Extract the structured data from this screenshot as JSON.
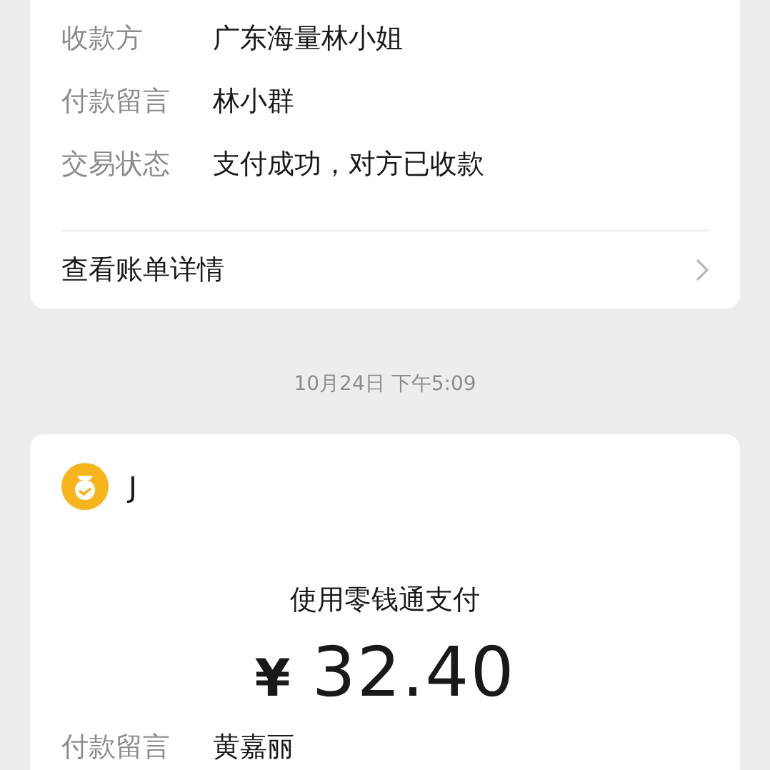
{
  "bill_card": {
    "rows": [
      {
        "label": "收款方",
        "value": "广东海量林小姐"
      },
      {
        "label": "付款留言",
        "value": "林小群"
      },
      {
        "label": "交易状态",
        "value": "支付成功，对方已收款"
      }
    ],
    "details_link": "查看账单详情"
  },
  "timestamp": "10月24日 下午5:09",
  "payment_card": {
    "payer": "J",
    "method": "使用零钱通支付",
    "currency": "¥",
    "amount": "32.40",
    "rows": [
      {
        "label": "付款留言",
        "value": "黄嘉丽"
      }
    ]
  }
}
